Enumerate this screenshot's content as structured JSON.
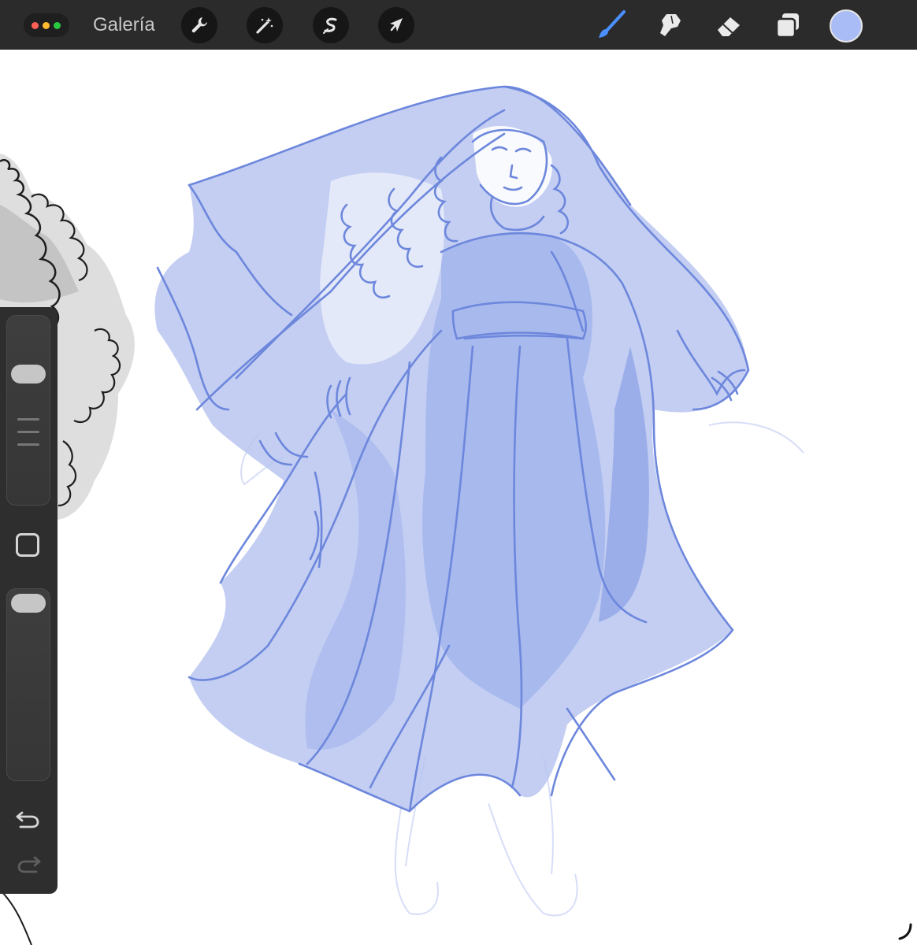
{
  "app": {
    "gallery_label": "Galería",
    "window_dots": [
      "#ff5f57",
      "#febc2e",
      "#28c840"
    ]
  },
  "toolbar_left": {
    "actions_icon": "wrench-icon",
    "adjustments_icon": "magic-wand-icon",
    "selection_icon": "selection-s-icon",
    "transform_icon": "arrow-cursor-icon"
  },
  "toolbar_right": {
    "brush_icon": "brush-icon",
    "smudge_icon": "smudge-finger-icon",
    "eraser_icon": "eraser-icon",
    "layers_icon": "layers-icon",
    "active_color": "#a9bcf5"
  },
  "sidebar": {
    "brush_size_icon": "brush-size-slider",
    "opacity_icon": "opacity-slider",
    "modify_icon": "square-modify-icon",
    "undo_icon": "undo-arrow-icon",
    "redo_icon": "redo-arrow-icon"
  },
  "canvas": {
    "sketch_color": "#6d87dc",
    "fill_color": "#b8c6f0",
    "faint_line_color": "#d7def7"
  }
}
